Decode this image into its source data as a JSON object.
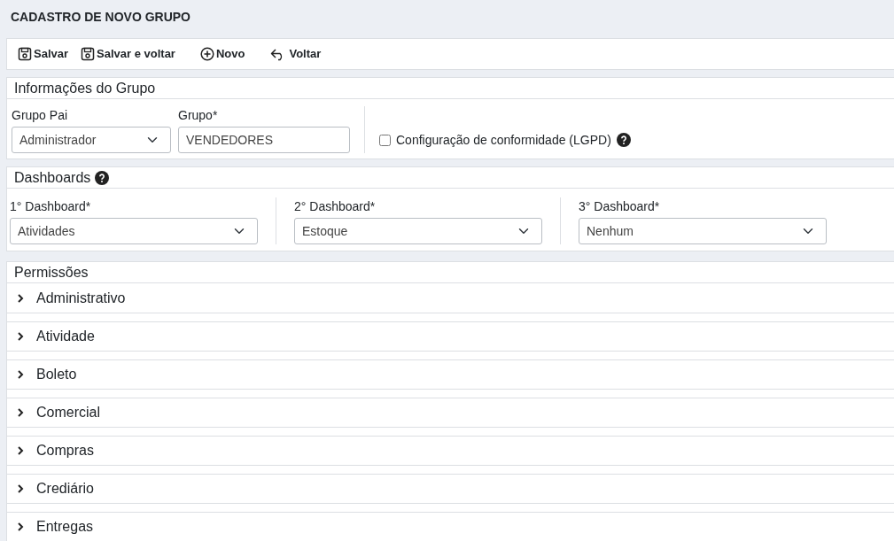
{
  "page_title": "CADASTRO DE NOVO GRUPO",
  "toolbar": [
    {
      "label": "Salvar",
      "kind": "save"
    },
    {
      "label": "Salvar e voltar",
      "kind": "save"
    },
    {
      "label": "Novo",
      "kind": "new"
    },
    {
      "label": "Voltar",
      "kind": "back"
    }
  ],
  "group_info": {
    "title": "Informações do Grupo",
    "parent_group": {
      "label": "Grupo Pai",
      "value": "Administrador"
    },
    "group": {
      "label": "Grupo*",
      "value": "VENDEDORES"
    },
    "lgpd": {
      "label": "Configuração de conformidade (LGPD)",
      "checked": false
    }
  },
  "dashboards": {
    "title": "Dashboards",
    "fields": [
      {
        "label": "1° Dashboard*",
        "value": "Atividades"
      },
      {
        "label": "2° Dashboard*",
        "value": "Estoque"
      },
      {
        "label": "3° Dashboard*",
        "value": "Nenhum"
      }
    ]
  },
  "permissions": {
    "title": "Permissões",
    "items": [
      {
        "label": "Administrativo",
        "expanded": false
      },
      {
        "label": "Atividade",
        "expanded": false
      },
      {
        "label": "Boleto",
        "expanded": false
      },
      {
        "label": "Comercial",
        "expanded": false
      },
      {
        "label": "Compras",
        "expanded": false
      },
      {
        "label": "Crediário",
        "expanded": false
      },
      {
        "label": "Entregas",
        "expanded": false
      }
    ]
  }
}
